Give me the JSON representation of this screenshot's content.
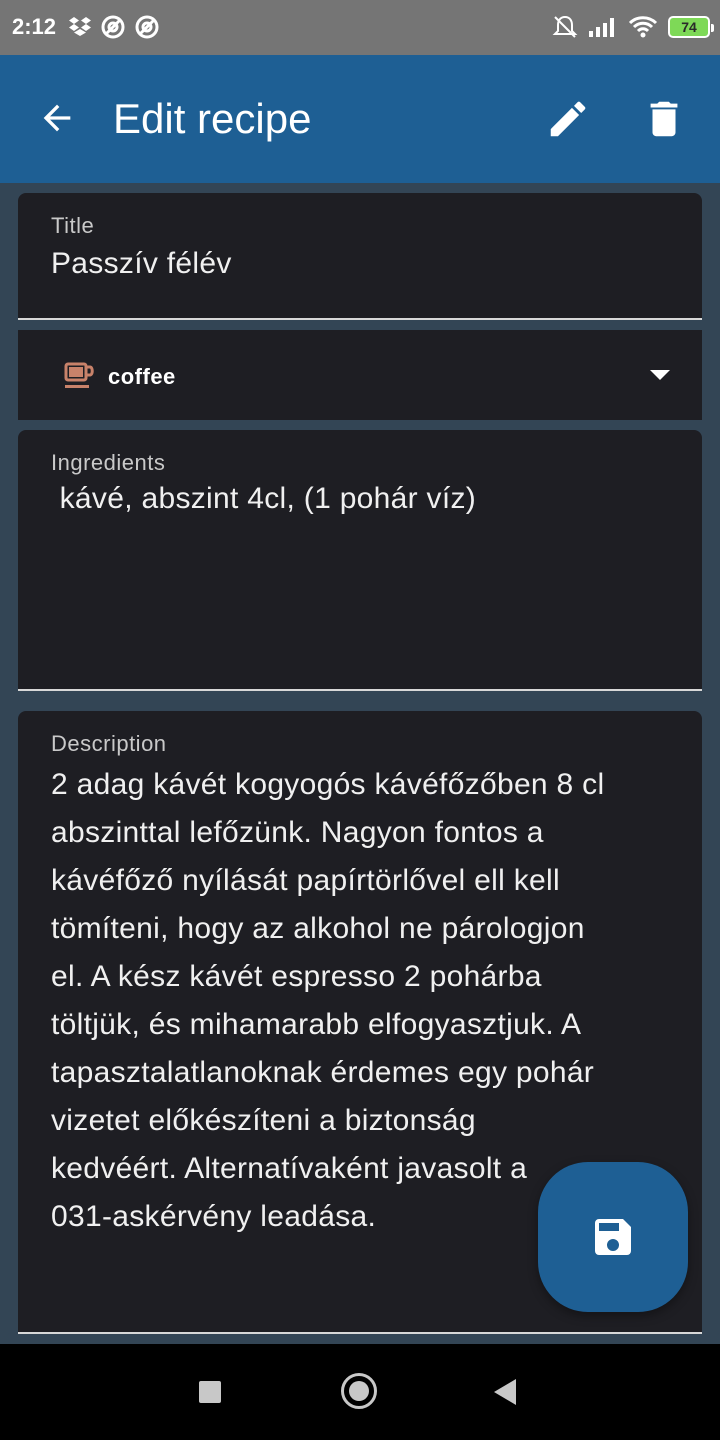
{
  "status_bar": {
    "time": "2:12",
    "battery": "74",
    "left_icons": [
      "dropbox-icon",
      "vpn-icon",
      "vpn-icon"
    ],
    "right_icons": [
      "mute-icon",
      "signal-icon",
      "wifi-icon",
      "battery-icon"
    ]
  },
  "app_bar": {
    "title": "Edit recipe",
    "back_icon": "arrow-back-icon",
    "actions": [
      "edit-icon",
      "delete-icon"
    ],
    "color": "#1e5f94"
  },
  "form": {
    "title": {
      "label": "Title",
      "value": "Passzív félév"
    },
    "category": {
      "icon": "coffee-icon",
      "value": "coffee"
    },
    "ingredients": {
      "label": "Ingredients",
      "value": " kávé, abszint 4cl, (1 pohár víz)"
    },
    "description": {
      "label": "Description",
      "value": "2 adag kávét kogyogós kávéfőzőben 8 cl\nabszinttal lefőzünk. Nagyon fontos a\nkávéfőző nyílását papírtörlővel ell kell\ntömíteni, hogy az alkohol ne párologjon\nel. A kész kávét espresso 2 pohárba\ntöltjük, és mihamarabb elfogyasztjuk. A\ntapasztalatlanoknak érdemes egy pohár\nvizetet előkészíteni a biztonság\nkedvéért. Alternatívaként javasolt a\n031-askérvény leadása."
    }
  },
  "fab": {
    "icon": "save-icon"
  },
  "nav_bar": {
    "buttons": [
      "recents-icon",
      "home-icon",
      "back-icon"
    ]
  }
}
